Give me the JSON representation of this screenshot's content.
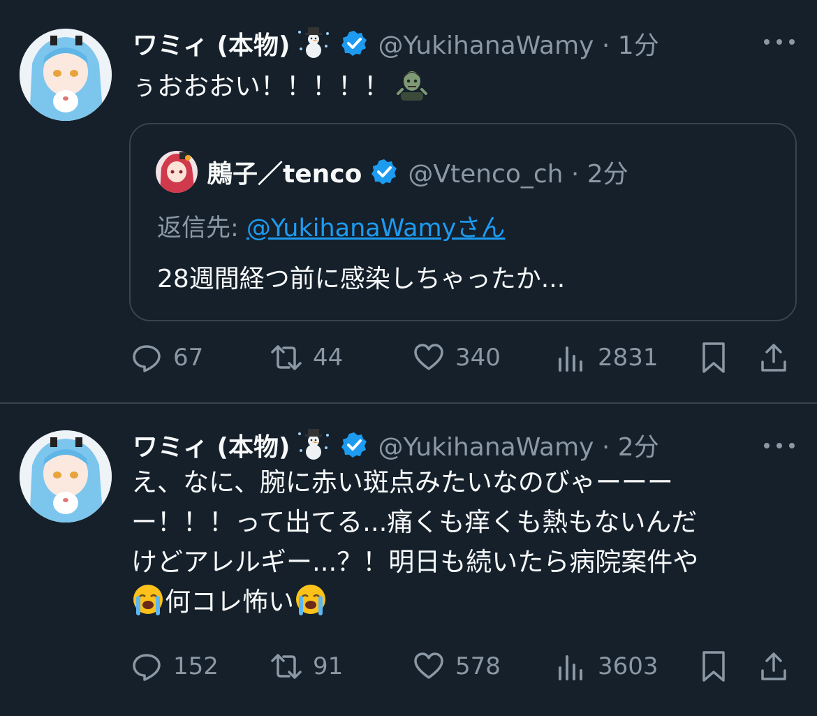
{
  "colors": {
    "background": "#15202b",
    "divider": "#38444d",
    "text": "#f7f9f9",
    "secondary": "#8b98a5",
    "link": "#1d9bf0",
    "verified": "#1d9bf0"
  },
  "tweets": [
    {
      "author_name": "ワミィ (本物)",
      "author_emoji": "snowman-emoji",
      "handle_time": "@YukihanaWamy · 1分",
      "lines": [
        "ぅおおおい！！！！！"
      ],
      "trailing_emoji": "zombie-emoji",
      "quote": {
        "author_name": "鶊子／tenco",
        "handle_time": "@Vtenco_ch · 2分",
        "reply_prefix": "返信先: ",
        "reply_link": "@YukihanaWamyさん",
        "text": "28週間経つ前に感染しちゃったか..."
      },
      "stats": {
        "replies": "67",
        "retweets": "44",
        "likes": "340",
        "views": "2831"
      }
    },
    {
      "author_name": "ワミィ (本物)",
      "author_emoji": "snowman-emoji",
      "handle_time": "@YukihanaWamy · 2分",
      "lines": [
        "え、なに、腕に赤い斑点みたいなのびゃーーー",
        "ー！！！って出てる...痛くも痒くも熱もないんだ",
        "けどアレルギー...？！明日も続いたら病院案件や"
      ],
      "last_line_text": "何コレ怖い",
      "stats": {
        "replies": "152",
        "retweets": "91",
        "likes": "578",
        "views": "3603"
      }
    }
  ]
}
